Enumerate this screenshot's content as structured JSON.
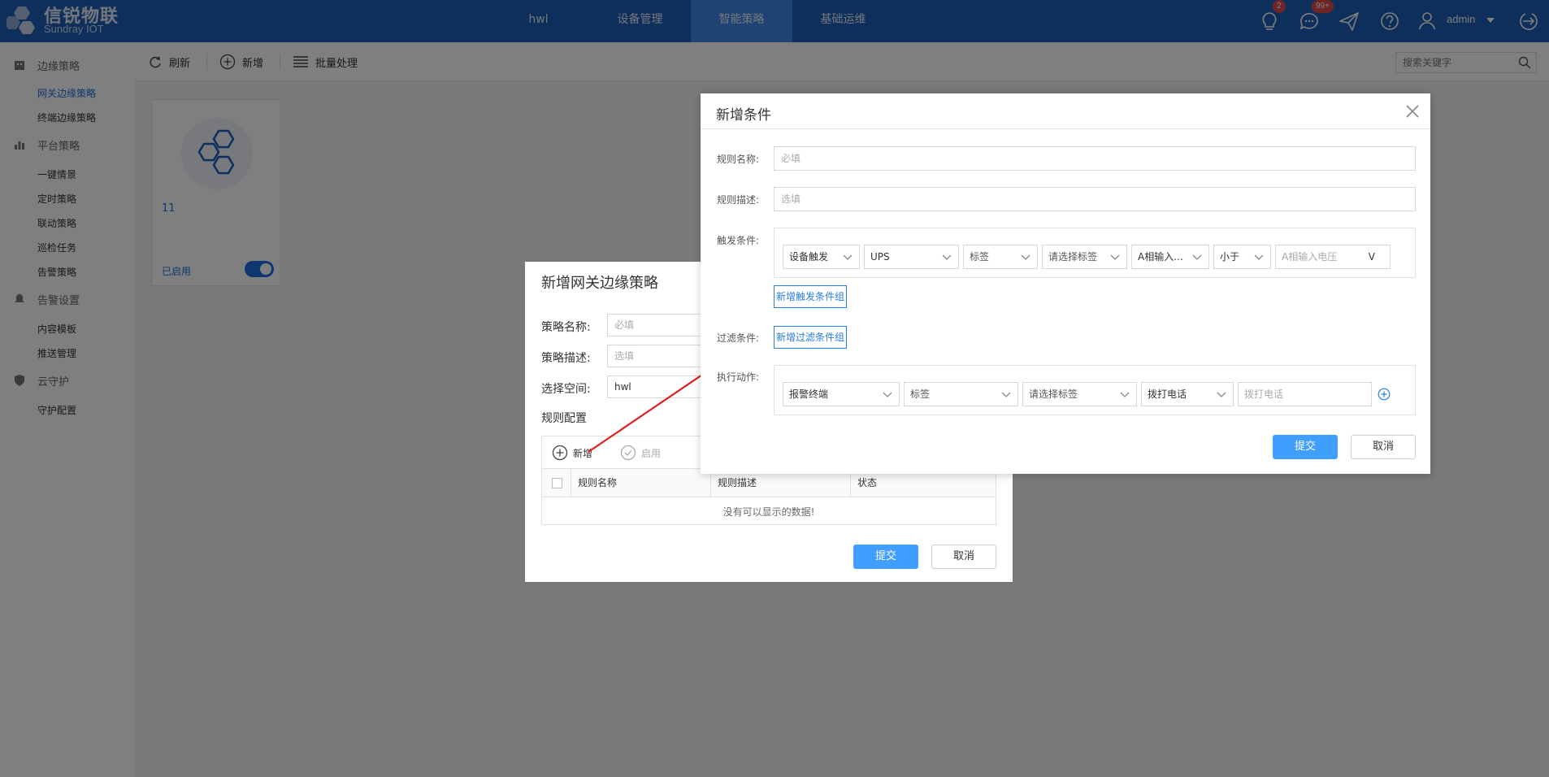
{
  "brand": {
    "name_cn": "信锐物联",
    "name_en": "Sundray IOT"
  },
  "nav": [
    {
      "label": "hwl",
      "active": false
    },
    {
      "label": "设备管理",
      "active": false
    },
    {
      "label": "智能策略",
      "active": true
    },
    {
      "label": "基础运维",
      "active": false
    }
  ],
  "header": {
    "bulb_badge": "2",
    "message_badge": "99+",
    "user": "admin"
  },
  "sidebar": {
    "groups": [
      {
        "label": "边缘策略",
        "icon": "building-icon",
        "items": [
          {
            "label": "网关边缘策略",
            "active": true
          },
          {
            "label": "终端边缘策略",
            "active": false
          }
        ]
      },
      {
        "label": "平台策略",
        "icon": "bar-chart-icon",
        "items": [
          {
            "label": "一键情景"
          },
          {
            "label": "定时策略"
          },
          {
            "label": "联动策略"
          },
          {
            "label": "巡检任务"
          },
          {
            "label": "告警策略"
          }
        ]
      },
      {
        "label": "告警设置",
        "icon": "bell-icon",
        "items": [
          {
            "label": "内容模板"
          },
          {
            "label": "推送管理"
          }
        ]
      },
      {
        "label": "云守护",
        "icon": "shield-icon",
        "items": [
          {
            "label": "守护配置"
          }
        ]
      }
    ]
  },
  "toolbar": {
    "refresh": "刷新",
    "add": "新增",
    "batch": "批量处理",
    "search_placeholder": "搜索关键字"
  },
  "card": {
    "title": "11",
    "status": "已启用",
    "enabled": true
  },
  "dialog1": {
    "title": "新增网关边缘策略",
    "name_label": "策略名称:",
    "name_placeholder": "必填",
    "desc_label": "策略描述:",
    "desc_placeholder": "选填",
    "space_label": "选择空间:",
    "space_value": "hwl",
    "rules_label": "规则配置",
    "add": "新增",
    "enable": "启用",
    "columns": [
      "规则名称",
      "规则描述",
      "状态"
    ],
    "empty_text": "没有可以显示的数据!",
    "submit": "提交",
    "cancel": "取消"
  },
  "dialog2": {
    "title": "新增条件",
    "rule_name_label": "规则名称:",
    "rule_name_placeholder": "必填",
    "rule_desc_label": "规则描述:",
    "rule_desc_placeholder": "选填",
    "trigger_label": "触发条件:",
    "trigger": {
      "type": "设备触发",
      "device": "UPS",
      "tag_type": "标签",
      "tag": "请选择标签",
      "metric": "A相输入...",
      "operator": "小于",
      "value_placeholder": "A相输入电压",
      "unit": "V"
    },
    "add_trigger_group": "新增触发条件组",
    "filter_label": "过滤条件:",
    "add_filter_group": "新增过滤条件组",
    "action_label": "执行动作:",
    "action": {
      "target": "报警终端",
      "tag_type": "标签",
      "tag": "请选择标签",
      "method": "拨打电话",
      "phone_placeholder": "拨打电话"
    },
    "submit": "提交",
    "cancel": "取消"
  },
  "colors": {
    "header_bg": "#1c5fb7",
    "nav_active": "#3d86e8",
    "primary": "#409eff",
    "link": "#2a7de1",
    "annotation": "#e02020"
  }
}
